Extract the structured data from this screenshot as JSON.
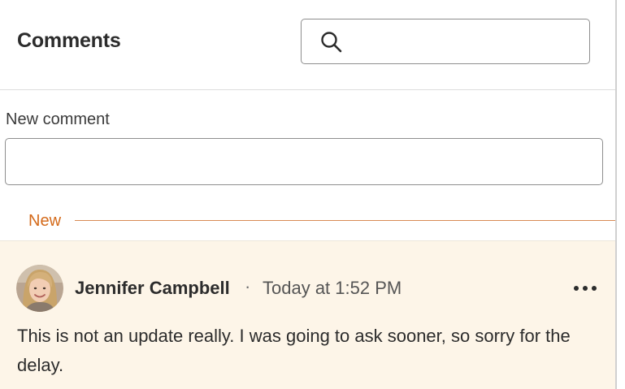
{
  "header": {
    "title": "Comments",
    "search": {
      "placeholder": "",
      "value": "",
      "icon": "search-icon"
    }
  },
  "composer": {
    "label": "New comment",
    "placeholder": "",
    "value": ""
  },
  "divider": {
    "label": "New",
    "color": "#d46a1a"
  },
  "comments": [
    {
      "author": "Jennifer Campbell",
      "separator": "·",
      "timestamp": "Today at 1:52 PM",
      "body": "This is not an update really. I was going to ask sooner, so sorry for the delay.",
      "avatar": "user-avatar",
      "menu_icon": "more-options-icon",
      "highlight_color": "#fdf5e8"
    }
  ]
}
